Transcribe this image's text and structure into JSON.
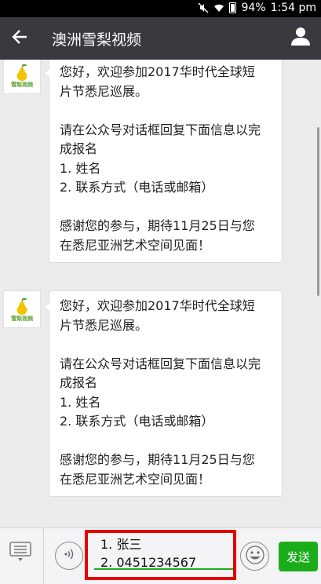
{
  "status_bar": {
    "battery": "94%",
    "time": "1:54 pm"
  },
  "nav": {
    "title": "澳洲雪梨视频"
  },
  "messages": [
    {
      "avatar_label": "雪梨视频",
      "paragraphs": [
        [
          "您好，欢迎参加2017华时代全球短",
          "片节悉尼巡展。"
        ],
        [
          "请在公众号对话框回复下面信息以完",
          "成报名",
          "1. 姓名",
          "2. 联系方式（电话或邮箱）"
        ],
        [
          "感谢您的参与，期待11月25日与您",
          "在悉尼亚洲艺术空间见面！"
        ]
      ]
    },
    {
      "avatar_label": "雪梨视频",
      "paragraphs": [
        [
          "您好，欢迎参加2017华时代全球短",
          "片节悉尼巡展。"
        ],
        [
          "请在公众号对话框回复下面信息以完",
          "成报名",
          "1. 姓名",
          "2. 联系方式（电话或邮箱）"
        ],
        [
          "感谢您的参与，期待11月25日与您",
          "在悉尼亚洲艺术空间见面！"
        ]
      ]
    }
  ],
  "input": {
    "lines": [
      "1. 张三",
      "2. 0451234567"
    ]
  },
  "send_label": "发送",
  "colors": {
    "nav_bg": "#393a3f",
    "accent_green": "#1aad19",
    "highlight_red": "#e60000",
    "chat_bg": "#ebebeb"
  },
  "icons": [
    "mute-icon",
    "wifi-icon",
    "battery-icon",
    "back-arrow-icon",
    "profile-icon",
    "menu-icon",
    "voice-icon",
    "emoji-icon"
  ]
}
